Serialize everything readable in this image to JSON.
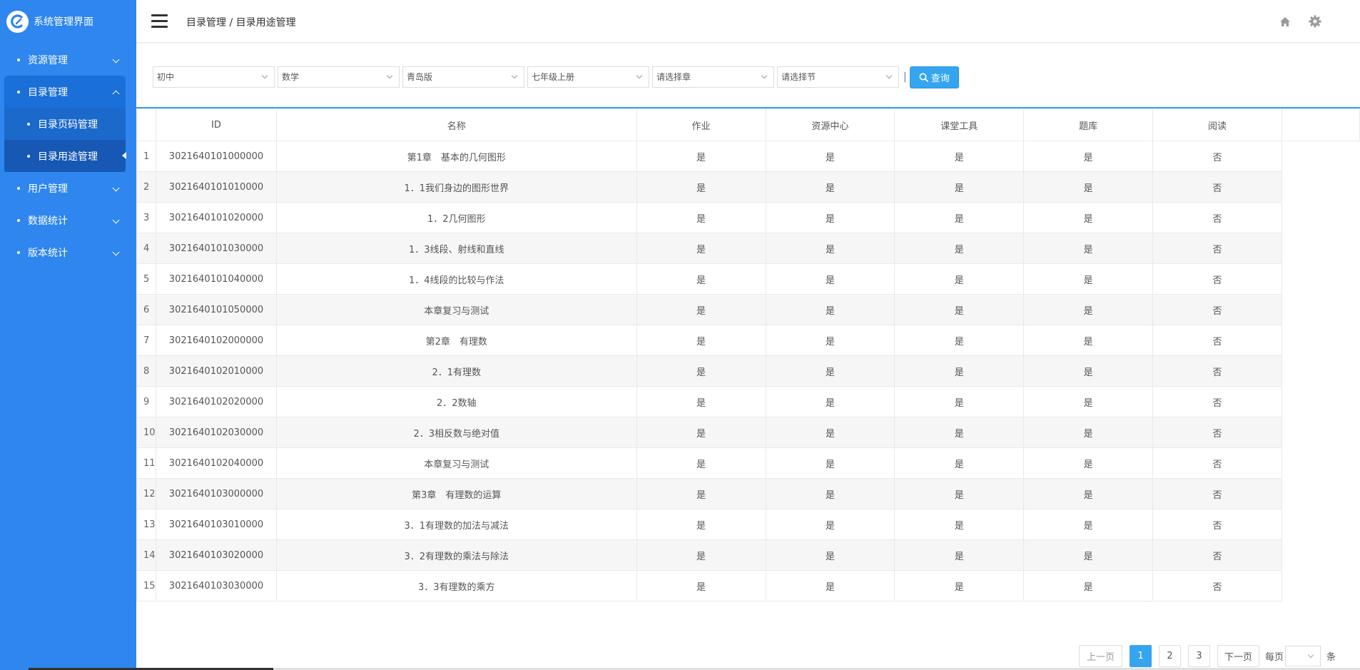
{
  "app": {
    "title": "系统管理界面"
  },
  "sidebar": {
    "items": [
      {
        "label": "资源管理"
      },
      {
        "label": "目录管理",
        "children": [
          {
            "label": "目录页码管理"
          },
          {
            "label": "目录用途管理"
          }
        ]
      },
      {
        "label": "用户管理"
      },
      {
        "label": "数据统计"
      },
      {
        "label": "版本统计"
      }
    ]
  },
  "header": {
    "breadcrumb": "目录管理 / 目录用途管理"
  },
  "filters": {
    "stage": "初中",
    "subject": "数学",
    "edition": "青岛版",
    "grade": "七年级上册",
    "chapter": "请选择章",
    "section": "请选择节",
    "separator": "|",
    "query_label": "查询"
  },
  "table": {
    "columns": [
      "",
      "ID",
      "名称",
      "作业",
      "资源中心",
      "课堂工具",
      "题库",
      "阅读"
    ],
    "rows": [
      [
        "1",
        "3021640101000000",
        "第1章　基本的几何图形",
        "是",
        "是",
        "是",
        "是",
        "否"
      ],
      [
        "2",
        "3021640101010000",
        "1．1我们身边的图形世界",
        "是",
        "是",
        "是",
        "是",
        "否"
      ],
      [
        "3",
        "3021640101020000",
        "1．2几何图形",
        "是",
        "是",
        "是",
        "是",
        "否"
      ],
      [
        "4",
        "3021640101030000",
        "1．3线段、射线和直线",
        "是",
        "是",
        "是",
        "是",
        "否"
      ],
      [
        "5",
        "3021640101040000",
        "1．4线段的比较与作法",
        "是",
        "是",
        "是",
        "是",
        "否"
      ],
      [
        "6",
        "3021640101050000",
        "本章复习与测试",
        "是",
        "是",
        "是",
        "是",
        "否"
      ],
      [
        "7",
        "3021640102000000",
        "第2章　有理数",
        "是",
        "是",
        "是",
        "是",
        "否"
      ],
      [
        "8",
        "3021640102010000",
        "2．1有理数",
        "是",
        "是",
        "是",
        "是",
        "否"
      ],
      [
        "9",
        "3021640102020000",
        "2．2数轴",
        "是",
        "是",
        "是",
        "是",
        "否"
      ],
      [
        "10",
        "3021640102030000",
        "2．3相反数与绝对值",
        "是",
        "是",
        "是",
        "是",
        "否"
      ],
      [
        "11",
        "3021640102040000",
        "本章复习与测试",
        "是",
        "是",
        "是",
        "是",
        "否"
      ],
      [
        "12",
        "3021640103000000",
        "第3章　有理数的运算",
        "是",
        "是",
        "是",
        "是",
        "否"
      ],
      [
        "13",
        "3021640103010000",
        "3．1有理数的加法与减法",
        "是",
        "是",
        "是",
        "是",
        "否"
      ],
      [
        "14",
        "3021640103020000",
        "3．2有理数的乘法与除法",
        "是",
        "是",
        "是",
        "是",
        "否"
      ],
      [
        "15",
        "3021640103030000",
        "3．3有理数的乘方",
        "是",
        "是",
        "是",
        "是",
        "否"
      ]
    ]
  },
  "pagination": {
    "prev_label": "上一页",
    "pages": [
      "1",
      "2",
      "3"
    ],
    "current": "1",
    "next_label": "下一页",
    "per_page_label": "每页",
    "per_page_value": "",
    "unit_label": "条"
  },
  "colors": {
    "sidebar": "#2e86ee",
    "accent": "#35a5ef"
  },
  "icons": {
    "home": "home-icon",
    "settings": "gear-icon",
    "menu": "hamburger-icon",
    "search": "search-icon"
  }
}
